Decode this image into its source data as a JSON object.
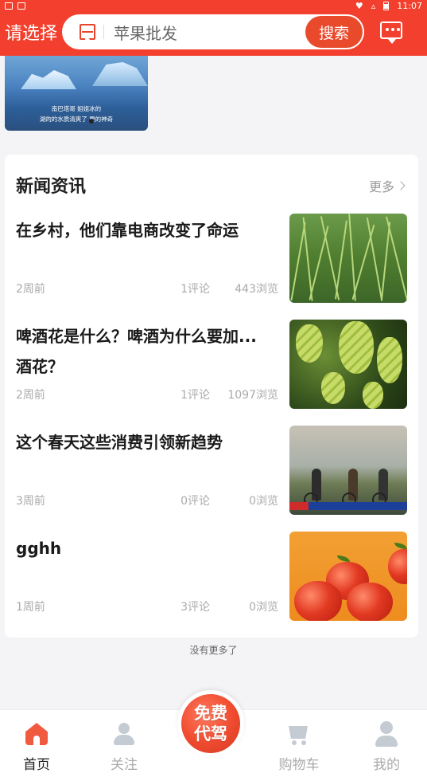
{
  "status_bar": {
    "time": "11:07"
  },
  "header": {
    "region_label": "请选择",
    "search_placeholder": "苹果批发",
    "search_button": "搜索"
  },
  "banner": {
    "caption_line1": "南巴塔哥 姐姐冰的",
    "caption_line2": "湖的的水质清爽了 更的神奇"
  },
  "news": {
    "title": "新闻资讯",
    "more_label": "更多",
    "items": [
      {
        "title": "在乡村，他们靠电商改变了命运",
        "time": "2周前",
        "comments": "1评论",
        "views": "443浏览",
        "image": "green-beans"
      },
      {
        "title": "啤酒花是什么？啤酒为什么要加...\n酒花？",
        "time": "2周前",
        "comments": "1评论",
        "views": "1097浏览",
        "image": "hops"
      },
      {
        "title": "这个春天这些消费引领新趋势",
        "time": "3周前",
        "comments": "0评论",
        "views": "0浏览",
        "image": "cyclists"
      },
      {
        "title": "gghh",
        "time": "1周前",
        "comments": "3评论",
        "views": "0浏览",
        "image": "apples"
      }
    ],
    "end_text": "没有更多了"
  },
  "tabbar": {
    "home": "首页",
    "follow": "关注",
    "center_line1": "免费",
    "center_line2": "代驾",
    "cart": "购物车",
    "me": "我的"
  },
  "colors": {
    "brand": "#f3402e",
    "accent": "#ea4a2c"
  }
}
